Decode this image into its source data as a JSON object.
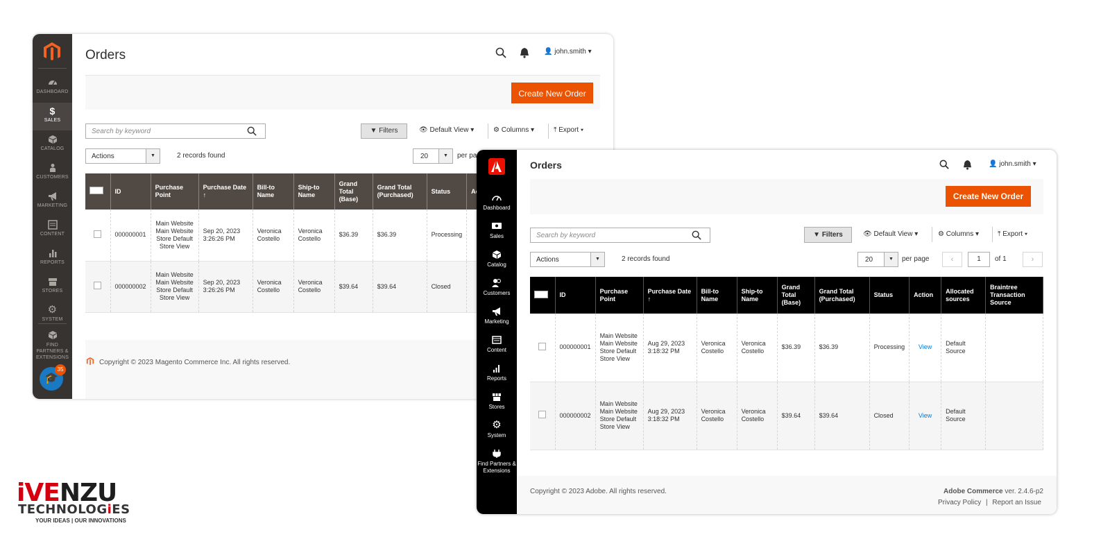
{
  "win1": {
    "sidebar": [
      {
        "icon": "dashboard-icon",
        "label": "DASHBOARD"
      },
      {
        "icon": "dollar-icon",
        "label": "SALES"
      },
      {
        "icon": "catalog-icon",
        "label": "CATALOG"
      },
      {
        "icon": "customers-icon",
        "label": "CUSTOMERS"
      },
      {
        "icon": "megaphone-icon",
        "label": "MARKETING"
      },
      {
        "icon": "content-icon",
        "label": "CONTENT"
      },
      {
        "icon": "reports-icon",
        "label": "REPORTS"
      },
      {
        "icon": "store-icon",
        "label": "STORES"
      },
      {
        "icon": "gear-icon",
        "label": "SYSTEM"
      },
      {
        "icon": "partners-icon",
        "label": "FIND PARTNERS & EXTENSIONS"
      }
    ],
    "learn_badge": "35",
    "title": "Orders",
    "user": "john.smith",
    "create_label": "Create New Order",
    "search_placeholder": "Search by keyword",
    "filters_label": "Filters",
    "view_label": "Default View",
    "columns_label": "Columns",
    "export_label": "Export",
    "actions_label": "Actions",
    "records": "2 records found",
    "per_page_value": "20",
    "per_page_label": "per pa",
    "headers": [
      "ID",
      "Purchase Point",
      "Purchase Date",
      "Bill-to Name",
      "Ship-to Name",
      "Grand Total (Base)",
      "Grand Total (Purchased)",
      "Status",
      "Ac"
    ],
    "rows": [
      {
        "id": "000000001",
        "point": "Main Website Main Website Store Default Store View",
        "date": "Sep 20, 2023 3:26:26 PM",
        "bill": "Veronica Costello",
        "ship": "Veronica Costello",
        "base": "$36.39",
        "purchased": "$36.39",
        "status": "Processing"
      },
      {
        "id": "000000002",
        "point": "Main Website Main Website Store Default Store View",
        "date": "Sep 20, 2023 3:26:26 PM",
        "bill": "Veronica Costello",
        "ship": "Veronica Costello",
        "base": "$39.64",
        "purchased": "$39.64",
        "status": "Closed"
      }
    ],
    "copyright": "Copyright © 2023 Magento Commerce Inc. All rights reserved."
  },
  "win2": {
    "sidebar": [
      {
        "icon": "dashboard-icon",
        "label": "Dashboard"
      },
      {
        "icon": "sales-icon",
        "label": "Sales"
      },
      {
        "icon": "catalog-icon",
        "label": "Catalog"
      },
      {
        "icon": "customers-icon",
        "label": "Customers"
      },
      {
        "icon": "megaphone-icon",
        "label": "Marketing"
      },
      {
        "icon": "content-icon",
        "label": "Content"
      },
      {
        "icon": "reports-icon",
        "label": "Reports"
      },
      {
        "icon": "store-icon",
        "label": "Stores"
      },
      {
        "icon": "gear-icon",
        "label": "System"
      },
      {
        "icon": "partners-icon",
        "label": "Find Partners & Extensions"
      }
    ],
    "title": "Orders",
    "user": "john.smith",
    "create_label": "Create New Order",
    "search_placeholder": "Search by keyword",
    "filters_label": "Filters",
    "view_label": "Default View",
    "columns_label": "Columns",
    "export_label": "Export",
    "actions_label": "Actions",
    "records": "2 records found",
    "per_page_value": "20",
    "per_page_label": "per page",
    "page_value": "1",
    "page_of": "of 1",
    "headers": [
      "ID",
      "Purchase Point",
      "Purchase Date",
      "Bill-to Name",
      "Ship-to Name",
      "Grand Total (Base)",
      "Grand Total (Purchased)",
      "Status",
      "Action",
      "Allocated sources",
      "Braintree Transaction Source"
    ],
    "rows": [
      {
        "id": "000000001",
        "point": "Main Website Main Website Store Default Store View",
        "date": "Aug 29, 2023 3:18:32 PM",
        "bill": "Veronica Costello",
        "ship": "Veronica Costello",
        "base": "$36.39",
        "purchased": "$36.39",
        "status": "Processing",
        "action": "View",
        "source": "Default Source"
      },
      {
        "id": "000000002",
        "point": "Main Website Main Website Store Default Store View",
        "date": "Aug 29, 2023 3:18:32 PM",
        "bill": "Veronica Costello",
        "ship": "Veronica Costello",
        "base": "$39.64",
        "purchased": "$39.64",
        "status": "Closed",
        "action": "View",
        "source": "Default Source"
      }
    ],
    "copyright": "Copyright © 2023 Adobe. All rights reserved.",
    "product": "Adobe Commerce",
    "version": " ver. 2.4.6-p2",
    "privacy": "Privacy Policy",
    "footer_sep": "|",
    "report": "Report an Issue"
  },
  "brand": {
    "i": "i",
    "v": "V",
    "e": "E",
    "rest": "NZU",
    "sub_a": "TECHNOLOG",
    "sub_i": "i",
    "sub_b": "ES",
    "tagline": "YOUR IDEAS  |  OUR INNOVATIONS"
  }
}
